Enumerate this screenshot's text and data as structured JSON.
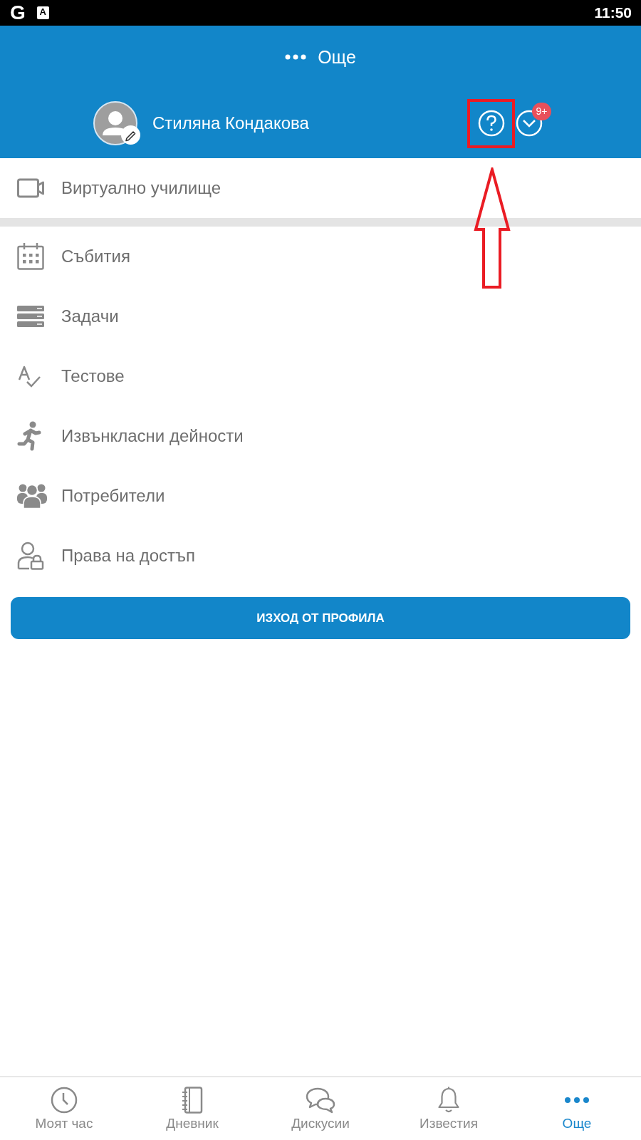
{
  "status_bar": {
    "notifications": [
      {
        "kind": "logo",
        "glyph": "G"
      },
      {
        "kind": "tile",
        "glyph": "A"
      }
    ],
    "time": "11:50"
  },
  "header": {
    "title": "Още",
    "user_name": "Стиляна Кондакова",
    "help_button": {
      "highlighted": true
    },
    "badge": "9+"
  },
  "menu": {
    "pinned": [
      {
        "kind": "video",
        "label": "Виртуално училище"
      }
    ],
    "items": [
      {
        "kind": "calendar",
        "label": "Събития"
      },
      {
        "kind": "tasks",
        "label": "Задачи"
      },
      {
        "kind": "tests",
        "label": "Тестове"
      },
      {
        "kind": "activities",
        "label": "Извънкласни дейности"
      },
      {
        "kind": "users",
        "label": "Потребители"
      },
      {
        "kind": "access",
        "label": "Права на достъп"
      }
    ]
  },
  "logout_button": "ИЗХОД ОТ ПРОФИЛА",
  "bottom_nav": [
    {
      "kind": "clock",
      "label": "Моят час",
      "selected": false
    },
    {
      "kind": "journal",
      "label": "Дневник",
      "selected": false
    },
    {
      "kind": "chat",
      "label": "Дискусии",
      "selected": false
    },
    {
      "kind": "bell",
      "label": "Известия",
      "selected": false
    },
    {
      "kind": "more",
      "label": "Още",
      "selected": true
    }
  ]
}
